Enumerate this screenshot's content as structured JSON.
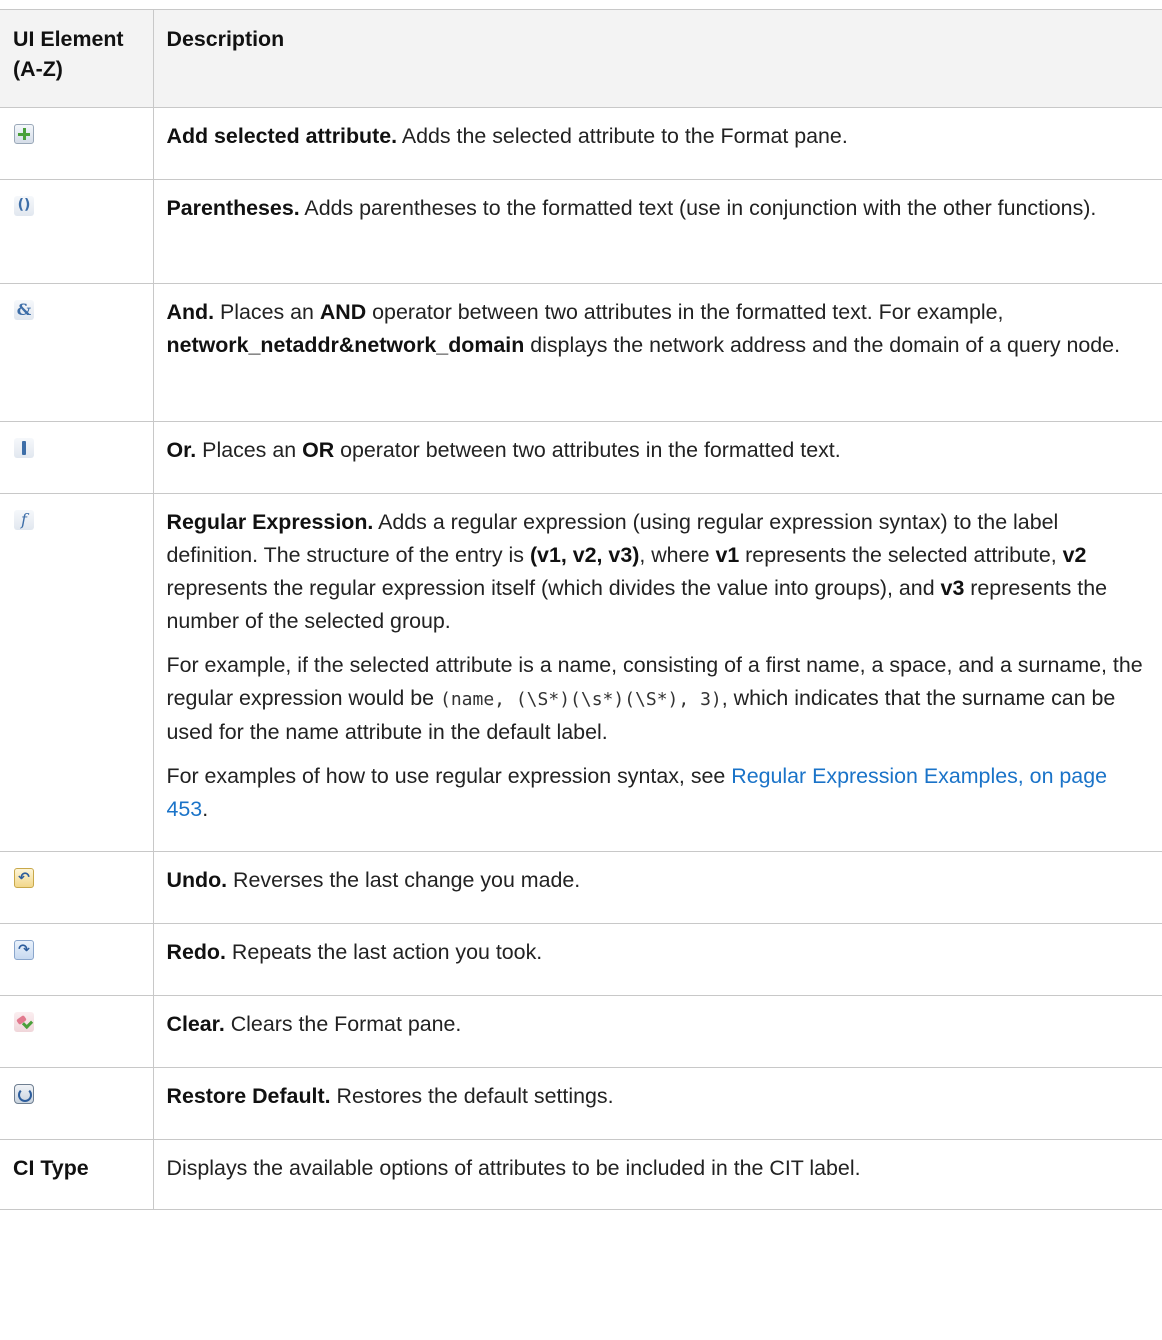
{
  "table": {
    "header": {
      "col1": "UI Element (A-Z)",
      "col2": "Description"
    },
    "rows": [
      {
        "icon": "add-attribute-icon",
        "title": "Add selected attribute.",
        "text": " Adds the selected attribute to the Format pane."
      },
      {
        "icon": "parentheses-icon",
        "icon_glyph": "()",
        "title": "Parentheses.",
        "text": " Adds parentheses to the formatted text (use in conjunction with the other functions)."
      },
      {
        "icon": "and-operator-icon",
        "icon_glyph": "&",
        "title": "And.",
        "t1": " Places an ",
        "b1": "AND",
        "t2": " operator between two attributes in the formatted text. For example, ",
        "b2": "network_netaddr&network_domain",
        "t3": " displays the network address and the domain of a query node."
      },
      {
        "icon": "or-operator-icon",
        "title": "Or.",
        "t1": " Places an ",
        "b1": "OR",
        "t2": " operator between two attributes in the formatted text."
      },
      {
        "icon": "regular-expression-icon",
        "icon_glyph": "f",
        "title": "Regular Expression.",
        "p1": {
          "t1": " Adds a regular expression (using regular expression syntax) to the label definition. The structure of the entry is ",
          "b1": "(v1, v2, v3)",
          "t2": ", where ",
          "b2": "v1",
          "t3": " represents the selected attribute, ",
          "b3": "v2",
          "t4": " represents the regular expression itself (which divides the value into groups), and ",
          "b4": "v3",
          "t5": " represents the number of the selected group."
        },
        "p2": {
          "t1": "For example, if the selected attribute is a name, consisting of a first name, a space, and a surname, the regular expression would be ",
          "code": "(name, (\\S*)(\\s*)(\\S*), 3)",
          "t2": ", which indicates that the surname can be used for the name attribute in the default label."
        },
        "p3": {
          "t1": "For examples of how to use regular expression syntax, see ",
          "link": "Regular Expression Examples, on page 453",
          "t2": "."
        }
      },
      {
        "icon": "undo-icon",
        "icon_glyph": "↶",
        "title": "Undo.",
        "text": " Reverses the last change you made."
      },
      {
        "icon": "redo-icon",
        "icon_glyph": "↷",
        "title": "Redo.",
        "text": " Repeats the last action you took."
      },
      {
        "icon": "clear-icon",
        "title": "Clear.",
        "text": " Clears the Format pane."
      },
      {
        "icon": "restore-default-icon",
        "title": "Restore Default.",
        "text": " Restores the default settings."
      },
      {
        "label": "CI Type",
        "text": "Displays the available options of attributes to be included in the CIT label."
      }
    ]
  },
  "colors": {
    "border": "#c8c8c8",
    "header_bg": "#f3f3f3",
    "link": "#1a73c8",
    "text": "#222222"
  }
}
